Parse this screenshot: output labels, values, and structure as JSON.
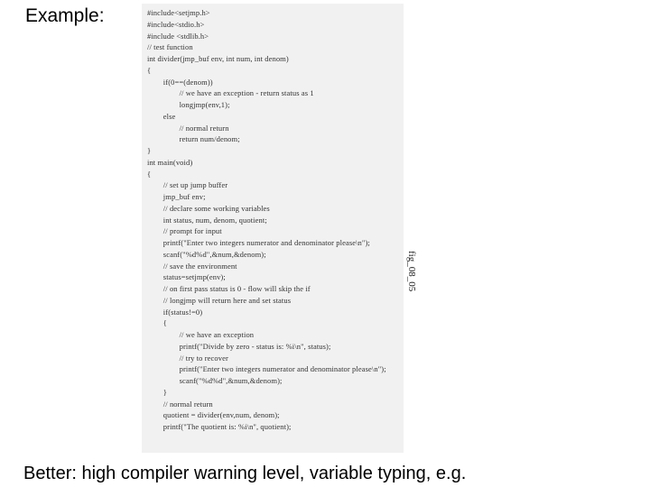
{
  "heading": "Example:",
  "footing": "Better: high compiler warning level, variable typing, e.g.",
  "fig_label": "fig_08_05",
  "code": [
    "#include<setjmp.h>",
    "#include<stdio.h>",
    "#include <stdlib.h>",
    "// test function",
    "int divider(jmp_buf env, int num, int denom)",
    "{",
    "        if(0==(denom))",
    "                // we have an exception - return status as 1",
    "                longjmp(env,1);",
    "        else",
    "                // normal return",
    "                return num/denom;",
    "}",
    "int main(void)",
    "{",
    "        // set up jump buffer",
    "        jmp_buf env;",
    "",
    "        // declare some working variables",
    "        int status, num, denom, quotient;",
    "",
    "        // prompt for input",
    "        printf(\"Enter two integers numerator and denominator please\\n\");",
    "        scanf(\"%d%d\",&num,&denom);",
    "",
    "        // save the environment",
    "        status=setjmp(env);",
    "",
    "        // on first pass status is 0 - flow will skip the if",
    "        // longjmp will return here and set status",
    "        if(status!=0)",
    "        {",
    "                // we have an exception",
    "                printf(\"Divide by zero - status is: %i\\n\", status);",
    "",
    "                // try to recover",
    "                printf(\"Enter two integers numerator and denominator please\\n\");",
    "                scanf(\"%d%d\",&num,&denom);",
    "        }",
    "        // normal return",
    "        quotient = divider(env,num, denom);",
    "        printf(\"The quotient is: %i\\n\", quotient);"
  ]
}
